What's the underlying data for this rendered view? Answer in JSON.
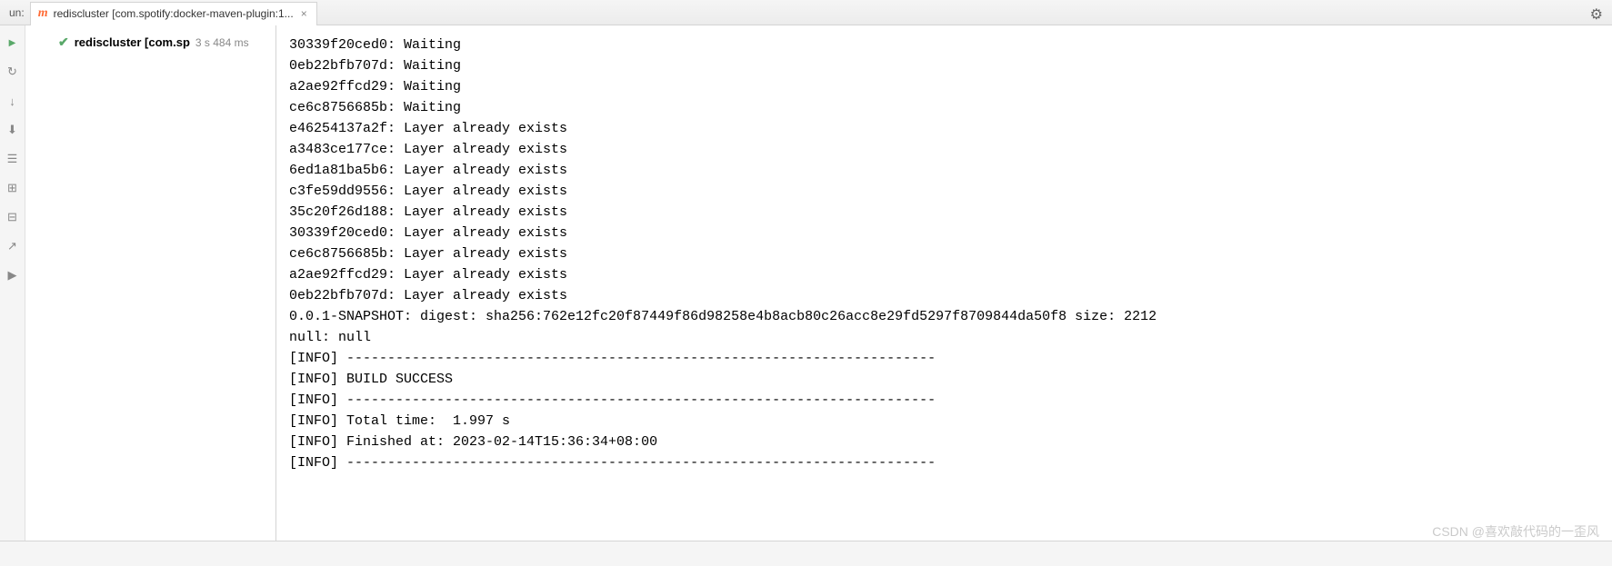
{
  "topbar": {
    "run_label": "un:",
    "tab_title": "rediscluster [com.spotify:docker-maven-plugin:1...",
    "close_symbol": "×",
    "maven_glyph": "m",
    "gear_glyph": "⚙"
  },
  "gutter": {
    "items": [
      "↻",
      "↓",
      "⬇",
      "☰",
      "⊞",
      "⊟",
      "↗",
      "▶"
    ]
  },
  "tree": {
    "check_glyph": "✔",
    "name": "rediscluster [com.sp",
    "time": "3 s 484 ms"
  },
  "console_lines": [
    "30339f20ced0: Waiting",
    "0eb22bfb707d: Waiting",
    "a2ae92ffcd29: Waiting",
    "ce6c8756685b: Waiting",
    "e46254137a2f: Layer already exists",
    "a3483ce177ce: Layer already exists",
    "6ed1a81ba5b6: Layer already exists",
    "c3fe59dd9556: Layer already exists",
    "35c20f26d188: Layer already exists",
    "30339f20ced0: Layer already exists",
    "ce6c8756685b: Layer already exists",
    "a2ae92ffcd29: Layer already exists",
    "0eb22bfb707d: Layer already exists",
    "0.0.1-SNAPSHOT: digest: sha256:762e12fc20f87449f86d98258e4b8acb80c26acc8e29fd5297f8709844da50f8 size: 2212",
    "null: null",
    "[INFO] ------------------------------------------------------------------------",
    "[INFO] BUILD SUCCESS",
    "[INFO] ------------------------------------------------------------------------",
    "[INFO] Total time:  1.997 s",
    "[INFO] Finished at: 2023-02-14T15:36:34+08:00",
    "[INFO] ------------------------------------------------------------------------"
  ],
  "watermark": "CSDN @喜欢敲代码的一歪风"
}
